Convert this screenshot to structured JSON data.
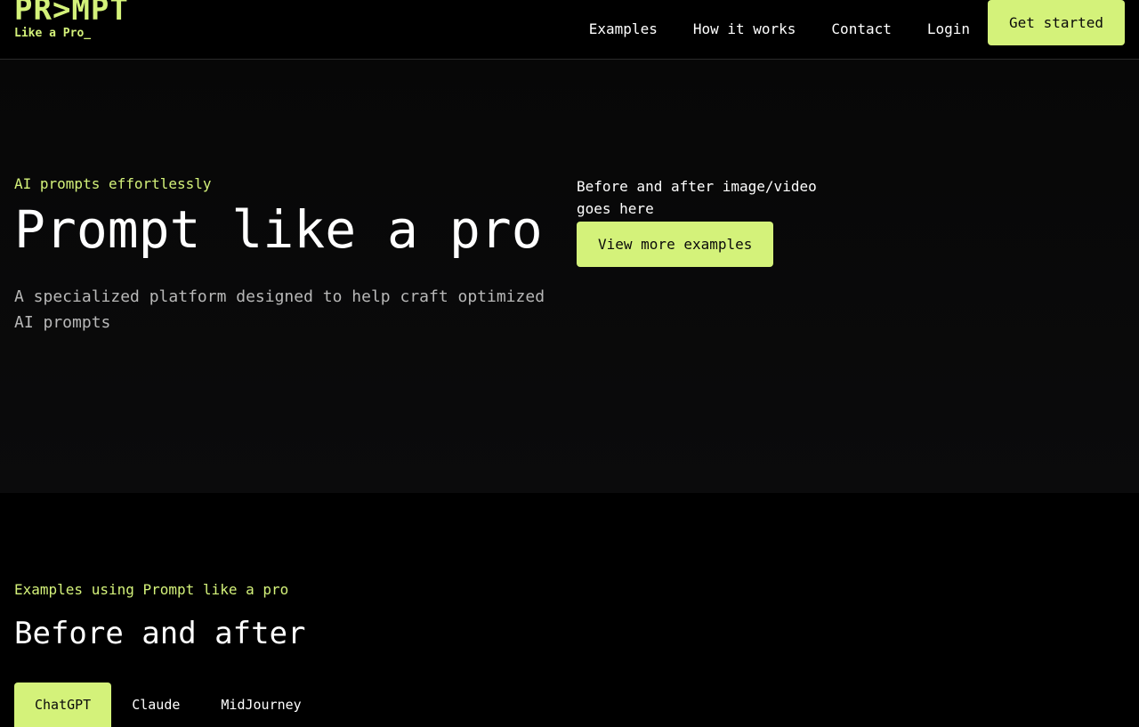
{
  "brand": {
    "logo_word": "PR>MPT",
    "logo_tagline": "Like a Pro_"
  },
  "nav": {
    "links": [
      "Examples",
      "How it works",
      "Contact",
      "Login"
    ],
    "cta_label": "Get started"
  },
  "hero": {
    "eyebrow": "AI prompts effortlessly",
    "title": "Prompt like a pro",
    "subtitle": "A specialized platform designed to help craft optimized AI prompts",
    "media_placeholder": "Before and after image/video goes here",
    "view_more_label": "View more examples"
  },
  "examples": {
    "eyebrow": "Examples using Prompt like a pro",
    "title": "Before and after",
    "tabs": [
      "ChatGPT",
      "Claude",
      "MidJourney"
    ],
    "active_tab": "ChatGPT"
  },
  "colors": {
    "accent": "#d4f27a",
    "background": "#000000",
    "hero_background": "#0a0a0a"
  }
}
